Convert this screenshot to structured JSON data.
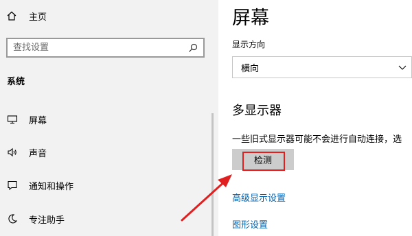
{
  "sidebar": {
    "home_label": "主页",
    "search_placeholder": "查找设置",
    "section_title": "系统",
    "items": [
      {
        "label": "屏幕",
        "icon": "monitor-icon"
      },
      {
        "label": "声音",
        "icon": "speaker-icon"
      },
      {
        "label": "通知和操作",
        "icon": "notification-icon"
      },
      {
        "label": "专注助手",
        "icon": "moon-icon"
      }
    ]
  },
  "main": {
    "title": "屏幕",
    "orientation_label": "显示方向",
    "orientation_value": "横向",
    "multi_display_title": "多显示器",
    "multi_display_desc": "一些旧式显示器可能不会进行自动连接，选",
    "detect_label": "检测",
    "advanced_link": "高级显示设置",
    "graphics_link": "图形设置"
  },
  "colors": {
    "sidebar_bg": "#f2f2f2",
    "link": "#0063b1",
    "highlight": "#e02020",
    "button_bg": "#cccccc"
  }
}
